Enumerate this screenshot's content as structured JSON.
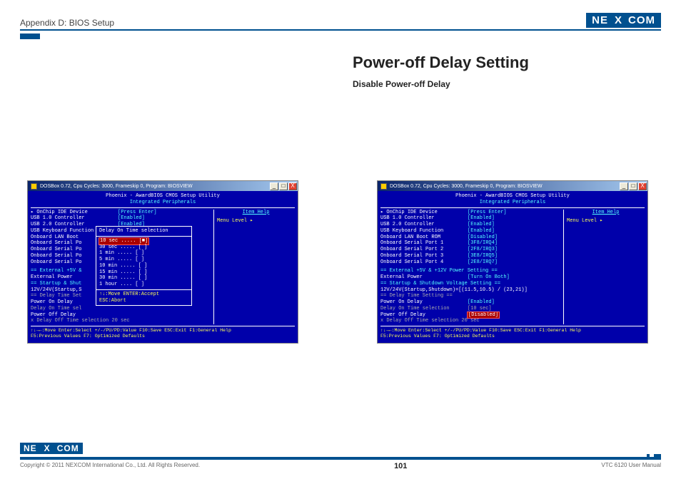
{
  "header": {
    "appendix": "Appendix D: BIOS Setup",
    "brand": {
      "ne": "NE",
      "x": "X",
      "com": "COM"
    }
  },
  "main": {
    "title": "Power-off Delay Setting",
    "subtitle": "Disable Power-off Delay"
  },
  "window": {
    "titlebar": "DOSBox 0.72, Cpu Cycles:    3000, Frameskip  0, Program: BIOSVIEW",
    "btn_min": "_",
    "btn_max": "□",
    "btn_close": "X"
  },
  "bios": {
    "title1": "Phoenix - AwardBIOS CMOS Setup Utility",
    "title2": "Integrated Peripherals",
    "item_help": "Item Help",
    "menu_level": "Menu Level  ▸",
    "hints_l1": "↑↓→←:Move  Enter:Select  +/-/PU/PD:Value   F10:Save  ESC:Exit  F1:General Help",
    "hints_l2": "F5:Previous Values          F7: Optimized Defaults"
  },
  "left_panel": {
    "rows": [
      {
        "k": "▸ OnChip IDE Device",
        "v": "[Press Enter]",
        "cls": ""
      },
      {
        "k": "  USB 1.0 Controller",
        "v": "[Enabled]",
        "cls": ""
      },
      {
        "k": "  USB 2.0 Controller",
        "v": "[Enabled]",
        "cls": ""
      },
      {
        "k": "  USB Keyboard Function",
        "v": "[Enabled]",
        "cls": ""
      },
      {
        "k": "  Onboard LAN Boot",
        "v": "",
        "cls": ""
      },
      {
        "k": "  Onboard Serial Po",
        "v": "",
        "cls": "cut"
      },
      {
        "k": "  Onboard Serial Po",
        "v": "",
        "cls": "cut"
      },
      {
        "k": "  Onboard Serial Po",
        "v": "",
        "cls": "cut"
      },
      {
        "k": "  Onboard Serial Po",
        "v": "",
        "cls": "cut"
      },
      {
        "k": "",
        "v": "",
        "cls": "blank"
      },
      {
        "k": "  == External +5V &",
        "v": "",
        "cls": "section"
      },
      {
        "k": "  External Power",
        "v": "",
        "cls": ""
      },
      {
        "k": "  == Startup & Shut",
        "v": "",
        "cls": "section"
      },
      {
        "k": "  12V/24V(Startup,S",
        "v": "",
        "cls": ""
      },
      {
        "k": "  == Delay Time Set",
        "v": "",
        "cls": "disabled"
      },
      {
        "k": "  Power On Delay",
        "v": "",
        "cls": ""
      },
      {
        "k": "  Delay On Time sel",
        "v": "",
        "cls": "disabled"
      },
      {
        "k": "  Power Off Delay",
        "v": "",
        "cls": ""
      },
      {
        "k": "x Delay Off Time selection   20 sec",
        "v": "",
        "cls": "x"
      }
    ],
    "popup": {
      "title": "Delay On Time selection",
      "options": [
        "10 sec ..... [■]",
        "30 sec ..... [ ]",
        " 1 min ..... [ ]",
        " 5 min ..... [ ]",
        "10 min ..... [ ]",
        "15 min ..... [ ]",
        "30 min ..... [ ]",
        " 1 hour .... [ ]"
      ],
      "hint": "↑↓:Move ENTER:Accept ESC:Abort"
    }
  },
  "right_panel": {
    "rows": [
      {
        "k": "▸ OnChip IDE Device",
        "v": "[Press Enter]"
      },
      {
        "k": "  USB 1.0 Controller",
        "v": "[Enabled]"
      },
      {
        "k": "  USB 2.0 Controller",
        "v": "[Enabled]"
      },
      {
        "k": "  USB Keyboard Function",
        "v": "[Enabled]"
      },
      {
        "k": "  Onboard LAN Boot ROM",
        "v": "[Disabled]"
      },
      {
        "k": "  Onboard Serial Port 1",
        "v": "[3F8/IRQ4]"
      },
      {
        "k": "  Onboard Serial Port 2",
        "v": "[2F8/IRQ3]"
      },
      {
        "k": "  Onboard Serial Port 3",
        "v": "[3E8/IRQ5]"
      },
      {
        "k": "  Onboard Serial Port 4",
        "v": "[2E8/IRQ7]"
      }
    ],
    "section1": "== External +5V & +12V Power Setting ==",
    "ext_power_k": "External Power",
    "ext_power_v": "[Turn On  Both]",
    "section2": "== Startup & Shutdown Voltage Setting ==",
    "volt_k": "12V/24V(Startup,Shutdown)=[(11.5,10.5) / (23,21)]",
    "section3": "== Delay Time Setting ==",
    "pon_k": "Power On Delay",
    "pon_v": "[Enabled]",
    "dons_k": "Delay On Time selection",
    "dons_v": "[10 sec]",
    "poff_k": "Power Off Delay",
    "poff_v": "[Disabled]",
    "doff": "x Delay Off Time selection   20 sec"
  },
  "footer": {
    "copyright": "Copyright © 2011 NEXCOM International Co., Ltd. All Rights Reserved.",
    "page": "101",
    "manual": "VTC 6120 User Manual"
  }
}
